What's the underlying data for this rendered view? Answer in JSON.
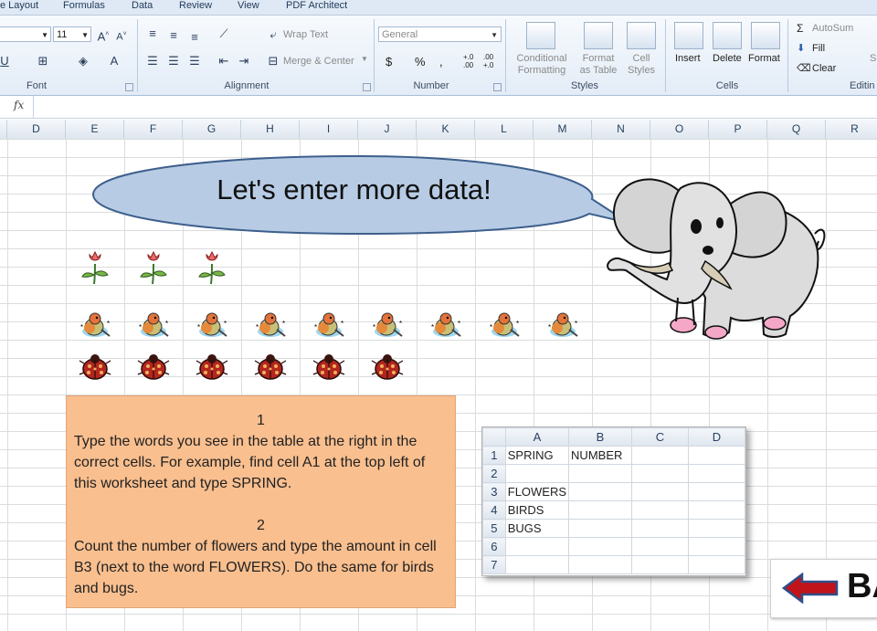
{
  "tabs": [
    "e Layout",
    "Formulas",
    "Data",
    "Review",
    "View",
    "PDF Architect"
  ],
  "ribbon": {
    "font": {
      "size": "11",
      "group_label": "Font"
    },
    "alignment": {
      "wrap_text": "Wrap Text",
      "merge_center": "Merge & Center",
      "group_label": "Alignment"
    },
    "number": {
      "format": "General",
      "currency": "$",
      "percent": "%",
      "comma": ",",
      "inc_decimal": "+.0 .00",
      "dec_decimal": ".00 +.0",
      "group_label": "Number"
    },
    "styles": {
      "conditional": [
        "Conditional",
        "Formatting"
      ],
      "format_table": [
        "Format",
        "as Table"
      ],
      "cell_styles": [
        "Cell",
        "Styles"
      ],
      "group_label": "Styles"
    },
    "cells": {
      "insert": "Insert",
      "delete": "Delete",
      "format": "Format",
      "group_label": "Cells"
    },
    "editing": {
      "autosum": "AutoSum",
      "fill": "Fill",
      "clear": "Clear",
      "group_label": "Editin",
      "extra": "S"
    }
  },
  "formula_bar": {
    "fx": "fx",
    "value": ""
  },
  "columns": [
    "D",
    "E",
    "F",
    "G",
    "H",
    "I",
    "J",
    "K",
    "L",
    "M",
    "N",
    "O",
    "P",
    "Q",
    "R"
  ],
  "bubble_text": "Let's enter more data!",
  "counts": {
    "flowers": 3,
    "birds": 9,
    "bugs": 6
  },
  "instructions": {
    "step1_num": "1",
    "step1_text": "Type the words you see in the table at the right in the correct cells. For example, find cell A1 at the top left of this worksheet and type SPRING.",
    "step2_num": "2",
    "step2_text": "Count the number of flowers and type the amount in cell B3 (next to the word FLOWERS). Do the same for birds  and bugs."
  },
  "mini_sheet": {
    "columns": [
      "A",
      "B",
      "C",
      "D"
    ],
    "rows": [
      {
        "n": "1",
        "a": "SPRING",
        "b": "NUMBER"
      },
      {
        "n": "2",
        "a": "",
        "b": ""
      },
      {
        "n": "3",
        "a": "FLOWERS",
        "b": ""
      },
      {
        "n": "4",
        "a": "BIRDS",
        "b": ""
      },
      {
        "n": "5",
        "a": "BUGS",
        "b": ""
      },
      {
        "n": "6",
        "a": "",
        "b": ""
      },
      {
        "n": "7",
        "a": "",
        "b": ""
      }
    ]
  },
  "back_button": "BA",
  "colors": {
    "instructions_bg": "#f9bf8f",
    "bubble_fill": "#b7cce4",
    "arrow_red": "#c0141a"
  }
}
